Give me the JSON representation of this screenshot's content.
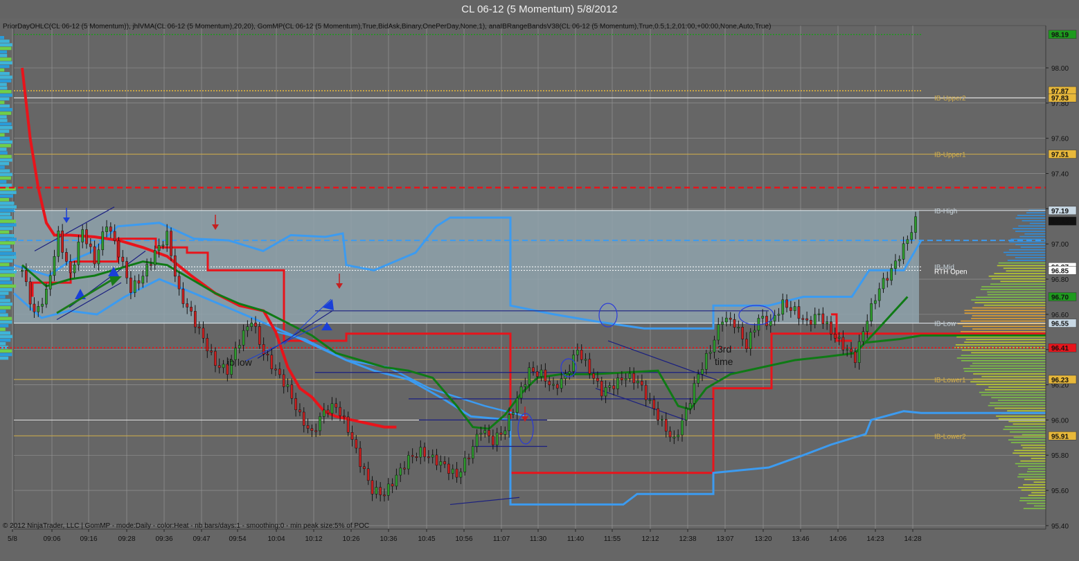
{
  "window": {
    "title": "CL 06-12 (5 Momentum)  5/8/2012"
  },
  "indicators_text": "PriorDayOHLC(CL 06-12 (5 Momentum)), jhlVMA(CL 06-12 (5 Momentum),20,20), GomMP(CL 06-12 (5 Momentum),True,BidAsk,Binary,OnePerDay,None,1), anaIBRangeBandsV38(CL 06-12 (5 Momentum),True,0.5,1,2,01:00,+00:00,None,Auto,True)",
  "footer_text": "© 2012 NinjaTrader, LLC | GomMP - mode:Daily - color:Heat - nb bars/days:1 - smoothing:0 - min peak size:5% of POC",
  "annotations": {
    "ib_low": "ib low",
    "third_time_1": "3rd",
    "third_time_2": "time"
  },
  "colors": {
    "background": "#666666",
    "ib_fill": "#8fa3ad",
    "price_red": "#e8141b",
    "vma_blue": "#3c9bf0",
    "green_line": "#0f7a15",
    "navy": "#1a1f80"
  },
  "chart_data": {
    "type": "candlestick",
    "instrument": "CL 06-12 (5 Momentum)",
    "date": "5/8/2012",
    "ylim": [
      95.38,
      98.24
    ],
    "y_ticks": [
      95.4,
      95.6,
      95.8,
      96.0,
      96.2,
      96.4,
      96.6,
      96.8,
      97.0,
      97.2,
      97.4,
      97.6,
      97.8,
      98.0
    ],
    "y_tick_labels": [
      "95.40",
      "95.60",
      "95.80",
      "96.00",
      "96.20",
      "96.40",
      "96.60",
      "96.80",
      "97.00",
      "97.20",
      "97.40",
      "97.60",
      "97.80",
      "98.00"
    ],
    "x_labels": [
      "5/8",
      "09:06",
      "09:16",
      "09:28",
      "09:36",
      "09:47",
      "09:54",
      "10:04",
      "10:12",
      "10:26",
      "10:36",
      "10:45",
      "10:56",
      "11:07",
      "11:30",
      "11:40",
      "11:55",
      "12:12",
      "12:38",
      "13:07",
      "13:20",
      "13:46",
      "14:06",
      "14:23",
      "14:28"
    ],
    "ib_bands": [
      {
        "label": "IB-Upper2",
        "value": 97.83
      },
      {
        "label": "IB-Upper1",
        "value": 97.51
      },
      {
        "label": "IB-High",
        "value": 97.19
      },
      {
        "label": "IB-Mid",
        "value": 96.87
      },
      {
        "label": "RTH Open",
        "value": 96.85
      },
      {
        "label": "IB-Low",
        "value": 96.55
      },
      {
        "label": "IB-Lower1",
        "value": 96.23
      },
      {
        "label": "IB-Lower2",
        "value": 95.91
      }
    ],
    "price_markers": [
      {
        "value": 98.19,
        "label": "98.19",
        "color": "#1e9a1e",
        "text": "#ffffff"
      },
      {
        "value": 97.87,
        "label": "97.87",
        "color": "#e8b83a",
        "text": "#111111"
      },
      {
        "value": 97.83,
        "label": "97.83",
        "color": "#e8b83a",
        "text": "#111111"
      },
      {
        "value": 97.51,
        "label": "97.51",
        "color": "#e8b83a",
        "text": "#111111"
      },
      {
        "value": 97.19,
        "label": "97.19",
        "color": "#c8d8e4",
        "text": "#111111"
      },
      {
        "value": 97.13,
        "label": "97.13",
        "color": "#111111",
        "text": "#ffffff"
      },
      {
        "value": 96.87,
        "label": "96.87",
        "color": "#ffffff",
        "text": "#111111"
      },
      {
        "value": 96.85,
        "label": "96.85",
        "color": "#ffffff",
        "text": "#111111"
      },
      {
        "value": 96.7,
        "label": "96.70",
        "color": "#1e9a1e",
        "text": "#ffffff"
      },
      {
        "value": 96.55,
        "label": "96.55",
        "color": "#c8d8e4",
        "text": "#111111"
      },
      {
        "value": 96.41,
        "label": "96.41",
        "color": "#e8141b",
        "text": "#ffffff"
      },
      {
        "value": 96.23,
        "label": "96.23",
        "color": "#e8b83a",
        "text": "#111111"
      },
      {
        "value": 95.91,
        "label": "95.91",
        "color": "#e8b83a",
        "text": "#111111"
      }
    ],
    "prior_day_levels": [
      97.32,
      96.41,
      98.19
    ],
    "close_path": [
      [
        0,
        96.85
      ],
      [
        3,
        96.6
      ],
      [
        6,
        96.72
      ],
      [
        9,
        97.05
      ],
      [
        12,
        96.82
      ],
      [
        15,
        97.08
      ],
      [
        18,
        96.9
      ],
      [
        21,
        97.12
      ],
      [
        24,
        96.95
      ],
      [
        27,
        96.74
      ],
      [
        30,
        96.82
      ],
      [
        33,
        96.95
      ],
      [
        36,
        97.05
      ],
      [
        39,
        96.72
      ],
      [
        42,
        96.6
      ],
      [
        45,
        96.46
      ],
      [
        48,
        96.32
      ],
      [
        51,
        96.28
      ],
      [
        54,
        96.45
      ],
      [
        57,
        96.57
      ],
      [
        60,
        96.38
      ],
      [
        63,
        96.28
      ],
      [
        66,
        96.18
      ],
      [
        69,
        96.02
      ],
      [
        72,
        95.92
      ],
      [
        75,
        96.05
      ],
      [
        78,
        96.08
      ],
      [
        81,
        95.95
      ],
      [
        84,
        95.76
      ],
      [
        87,
        95.6
      ],
      [
        90,
        95.58
      ],
      [
        93,
        95.68
      ],
      [
        96,
        95.78
      ],
      [
        99,
        95.82
      ],
      [
        102,
        95.78
      ],
      [
        105,
        95.74
      ],
      [
        108,
        95.68
      ],
      [
        111,
        95.8
      ],
      [
        114,
        95.95
      ],
      [
        117,
        95.88
      ],
      [
        120,
        95.95
      ],
      [
        123,
        96.12
      ],
      [
        126,
        96.28
      ],
      [
        129,
        96.26
      ],
      [
        132,
        96.18
      ],
      [
        135,
        96.25
      ],
      [
        138,
        96.4
      ],
      [
        141,
        96.28
      ],
      [
        144,
        96.16
      ],
      [
        147,
        96.2
      ],
      [
        150,
        96.25
      ],
      [
        153,
        96.22
      ],
      [
        156,
        96.1
      ],
      [
        159,
        95.98
      ],
      [
        162,
        95.88
      ],
      [
        165,
        96.05
      ],
      [
        168,
        96.26
      ],
      [
        171,
        96.4
      ],
      [
        174,
        96.58
      ],
      [
        177,
        96.55
      ],
      [
        180,
        96.42
      ],
      [
        183,
        96.58
      ],
      [
        186,
        96.55
      ],
      [
        189,
        96.66
      ],
      [
        192,
        96.62
      ],
      [
        195,
        96.55
      ],
      [
        198,
        96.6
      ],
      [
        201,
        96.5
      ],
      [
        204,
        96.42
      ],
      [
        207,
        96.35
      ],
      [
        210,
        96.58
      ],
      [
        213,
        96.75
      ],
      [
        216,
        96.85
      ],
      [
        219,
        96.98
      ],
      [
        222,
        97.13
      ]
    ],
    "vma_red_path": [
      [
        0,
        98.0
      ],
      [
        2,
        97.6
      ],
      [
        4,
        97.32
      ],
      [
        6,
        97.12
      ],
      [
        8,
        97.05
      ],
      [
        12,
        97.05
      ],
      [
        18,
        97.04
      ],
      [
        24,
        97.02
      ],
      [
        30,
        96.98
      ],
      [
        36,
        96.93
      ],
      [
        42,
        96.82
      ],
      [
        48,
        96.72
      ],
      [
        54,
        96.65
      ],
      [
        60,
        96.62
      ],
      [
        63,
        96.5
      ],
      [
        66,
        96.3
      ],
      [
        69,
        96.18
      ],
      [
        72,
        96.13
      ],
      [
        75,
        96.05
      ],
      [
        78,
        96.02
      ],
      [
        82,
        96.0
      ],
      [
        86,
        95.98
      ],
      [
        90,
        95.96
      ],
      [
        93,
        95.96
      ]
    ],
    "green_path": [
      [
        0,
        96.88
      ],
      [
        6,
        96.76
      ],
      [
        12,
        96.8
      ],
      [
        18,
        96.82
      ],
      [
        24,
        96.86
      ],
      [
        30,
        96.9
      ],
      [
        36,
        96.88
      ],
      [
        42,
        96.8
      ],
      [
        48,
        96.72
      ],
      [
        54,
        96.66
      ],
      [
        60,
        96.62
      ],
      [
        66,
        96.55
      ],
      [
        72,
        96.48
      ],
      [
        78,
        96.38
      ],
      [
        84,
        96.34
      ],
      [
        90,
        96.3
      ],
      [
        96,
        96.28
      ],
      [
        102,
        96.24
      ],
      [
        108,
        96.08
      ],
      [
        112,
        95.96
      ],
      [
        116,
        95.95
      ],
      [
        120,
        96.03
      ],
      [
        124,
        96.15
      ],
      [
        128,
        96.24
      ],
      [
        134,
        96.26
      ],
      [
        142,
        96.26
      ],
      [
        150,
        96.27
      ],
      [
        158,
        96.28
      ],
      [
        163,
        96.08
      ],
      [
        166,
        96.06
      ],
      [
        170,
        96.18
      ],
      [
        176,
        96.26
      ],
      [
        184,
        96.3
      ],
      [
        192,
        96.34
      ],
      [
        200,
        96.36
      ],
      [
        207,
        96.38
      ],
      [
        212,
        96.5
      ],
      [
        216,
        96.6
      ],
      [
        220,
        96.7
      ]
    ]
  }
}
